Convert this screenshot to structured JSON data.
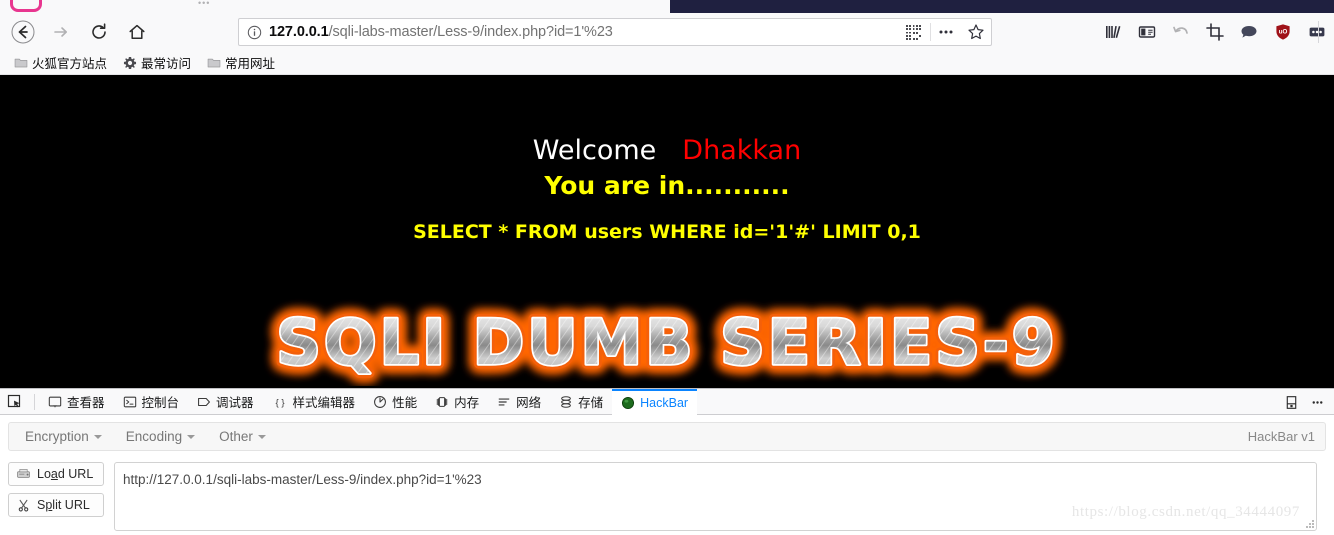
{
  "browser": {
    "nav": {
      "back_icon": "arrow-left-icon",
      "forward_icon": "arrow-right-icon",
      "reload_icon": "reload-icon",
      "home_icon": "home-icon"
    },
    "urlbar": {
      "identity_icon": "info-circle-icon",
      "host": "127.0.0.1",
      "path": "/sqli-labs-master/Less-9/index.php?id=1'%23",
      "full_url": "127.0.0.1/sqli-labs-master/Less-9/index.php?id=1'%23",
      "qr_icon": "qr-code-icon",
      "page_actions_icon": "ellipsis-icon",
      "bookmark_icon": "star-icon"
    },
    "toolbar_icons": [
      "library-icon",
      "sidebar-icon",
      "undo-icon",
      "screenshot-crop-icon",
      "chat-bubble-icon",
      "ublock-shield-icon",
      "overflow-menu-icon"
    ],
    "bookmarks": [
      {
        "label": "火狐官方站点",
        "icon": "folder-icon"
      },
      {
        "label": "最常访问",
        "icon": "gear-icon"
      },
      {
        "label": "常用网址",
        "icon": "folder-icon"
      }
    ]
  },
  "page": {
    "welcome": "Welcome",
    "username": "Dhakkan",
    "status_line": "You are in...........",
    "sql_query": "SELECT * FROM users WHERE id='1'#' LIMIT 0,1",
    "banner_text": "SQLI DUMB SERIES-9",
    "background_color": "#000000",
    "welcome_color": "#ffffff",
    "username_color": "#ff0000",
    "status_color": "#ffff00",
    "sql_color": "#ffff00",
    "banner_glow_color": "#ff6600"
  },
  "devtools": {
    "picker_icon": "element-picker-icon",
    "tabs": [
      {
        "label": "查看器",
        "icon": "inspector-icon",
        "active": false
      },
      {
        "label": "控制台",
        "icon": "console-icon",
        "active": false
      },
      {
        "label": "调试器",
        "icon": "debugger-icon",
        "active": false
      },
      {
        "label": "样式编辑器",
        "icon": "style-editor-icon",
        "active": false
      },
      {
        "label": "性能",
        "icon": "performance-icon",
        "active": false
      },
      {
        "label": "内存",
        "icon": "memory-icon",
        "active": false
      },
      {
        "label": "网络",
        "icon": "network-icon",
        "active": false
      },
      {
        "label": "存储",
        "icon": "storage-icon",
        "active": false
      },
      {
        "label": "HackBar",
        "icon": "hackbar-icon",
        "active": true
      }
    ],
    "active_tab_color": "#0a84ff",
    "right_icons": [
      "dock-position-icon",
      "devtools-options-icon"
    ]
  },
  "hackbar": {
    "menus": [
      {
        "label": "Encryption"
      },
      {
        "label": "Encoding"
      },
      {
        "label": "Other"
      }
    ],
    "version_label": "HackBar v1",
    "buttons": [
      {
        "label_pre": "Lo",
        "accel": "a",
        "label_post": "d URL",
        "icon": "load-url-icon",
        "name": "load-url-button"
      },
      {
        "label_pre": "S",
        "accel": "p",
        "label_post": "lit URL",
        "icon": "scissors-icon",
        "name": "split-url-button"
      }
    ],
    "url_value": "http://127.0.0.1/sqli-labs-master/Less-9/index.php?id=1'%23",
    "url_placeholder": "",
    "watermark": "https://blog.csdn.net/qq_34444097"
  }
}
